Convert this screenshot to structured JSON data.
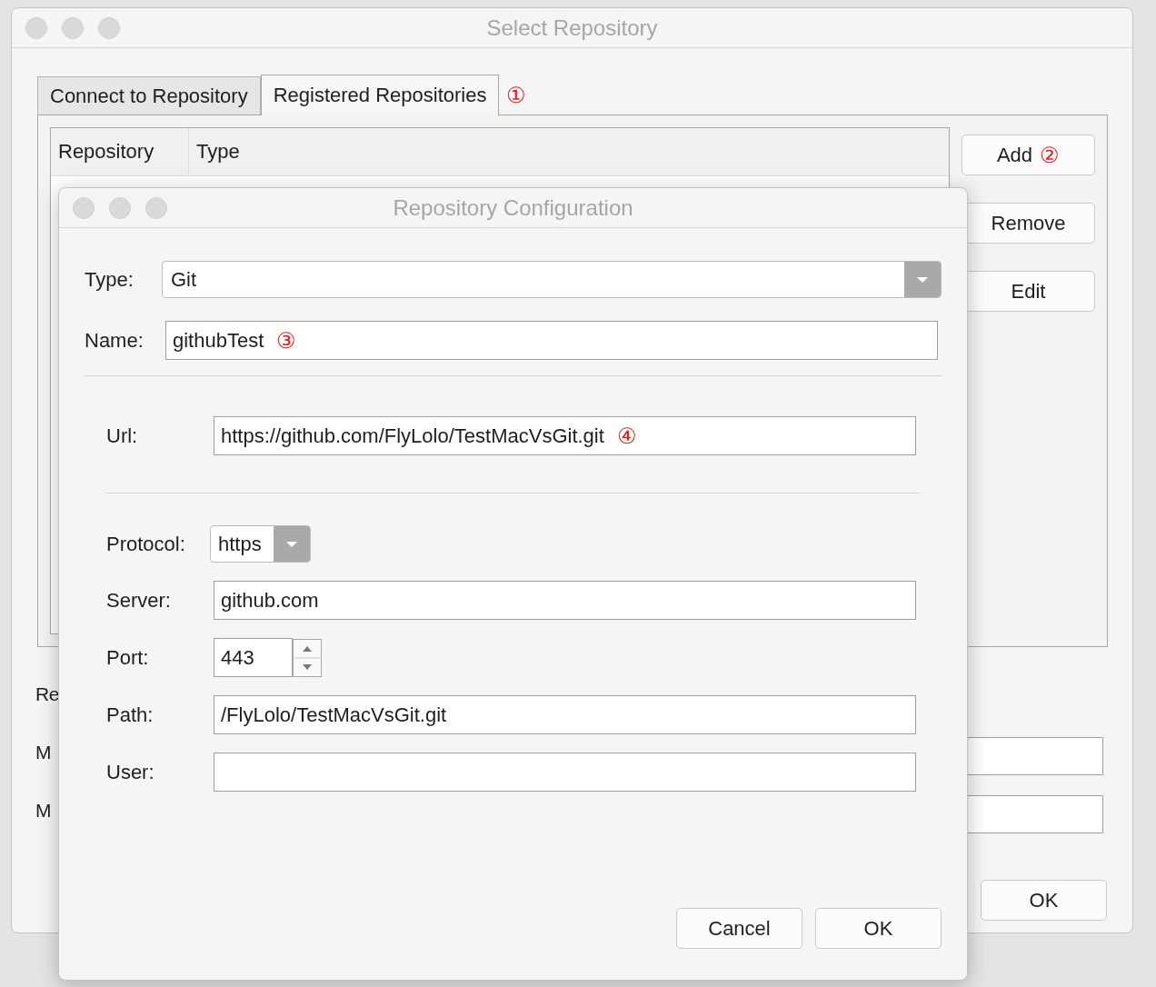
{
  "back_window": {
    "title": "Select Repository",
    "tabs": [
      {
        "label": "Connect to Repository",
        "selected": false
      },
      {
        "label": "Registered Repositories",
        "selected": true,
        "annotation": "①"
      }
    ],
    "table": {
      "columns": [
        "Repository",
        "Type"
      ]
    },
    "side_buttons": [
      {
        "label": "Add",
        "annotation": "②"
      },
      {
        "label": "Remove"
      },
      {
        "label": "Edit"
      }
    ],
    "rows": [
      {
        "kind": "text",
        "label": "Re"
      },
      {
        "kind": "field",
        "label": "M"
      },
      {
        "kind": "field",
        "label": "M"
      }
    ],
    "ok_button": "OK"
  },
  "dialog": {
    "title": "Repository Configuration",
    "type": {
      "label": "Type:",
      "value": "Git"
    },
    "name": {
      "label": "Name:",
      "value": "githubTest",
      "annotation": "③"
    },
    "url": {
      "label": "Url:",
      "value": "https://github.com/FlyLolo/TestMacVsGit.git",
      "annotation": "④"
    },
    "protocol": {
      "label": "Protocol:",
      "value": "https"
    },
    "server": {
      "label": "Server:",
      "value": "github.com"
    },
    "port": {
      "label": "Port:",
      "value": "443"
    },
    "path": {
      "label": "Path:",
      "value": "/FlyLolo/TestMacVsGit.git"
    },
    "user": {
      "label": "User:"
    },
    "buttons": [
      "Cancel",
      "OK"
    ]
  }
}
